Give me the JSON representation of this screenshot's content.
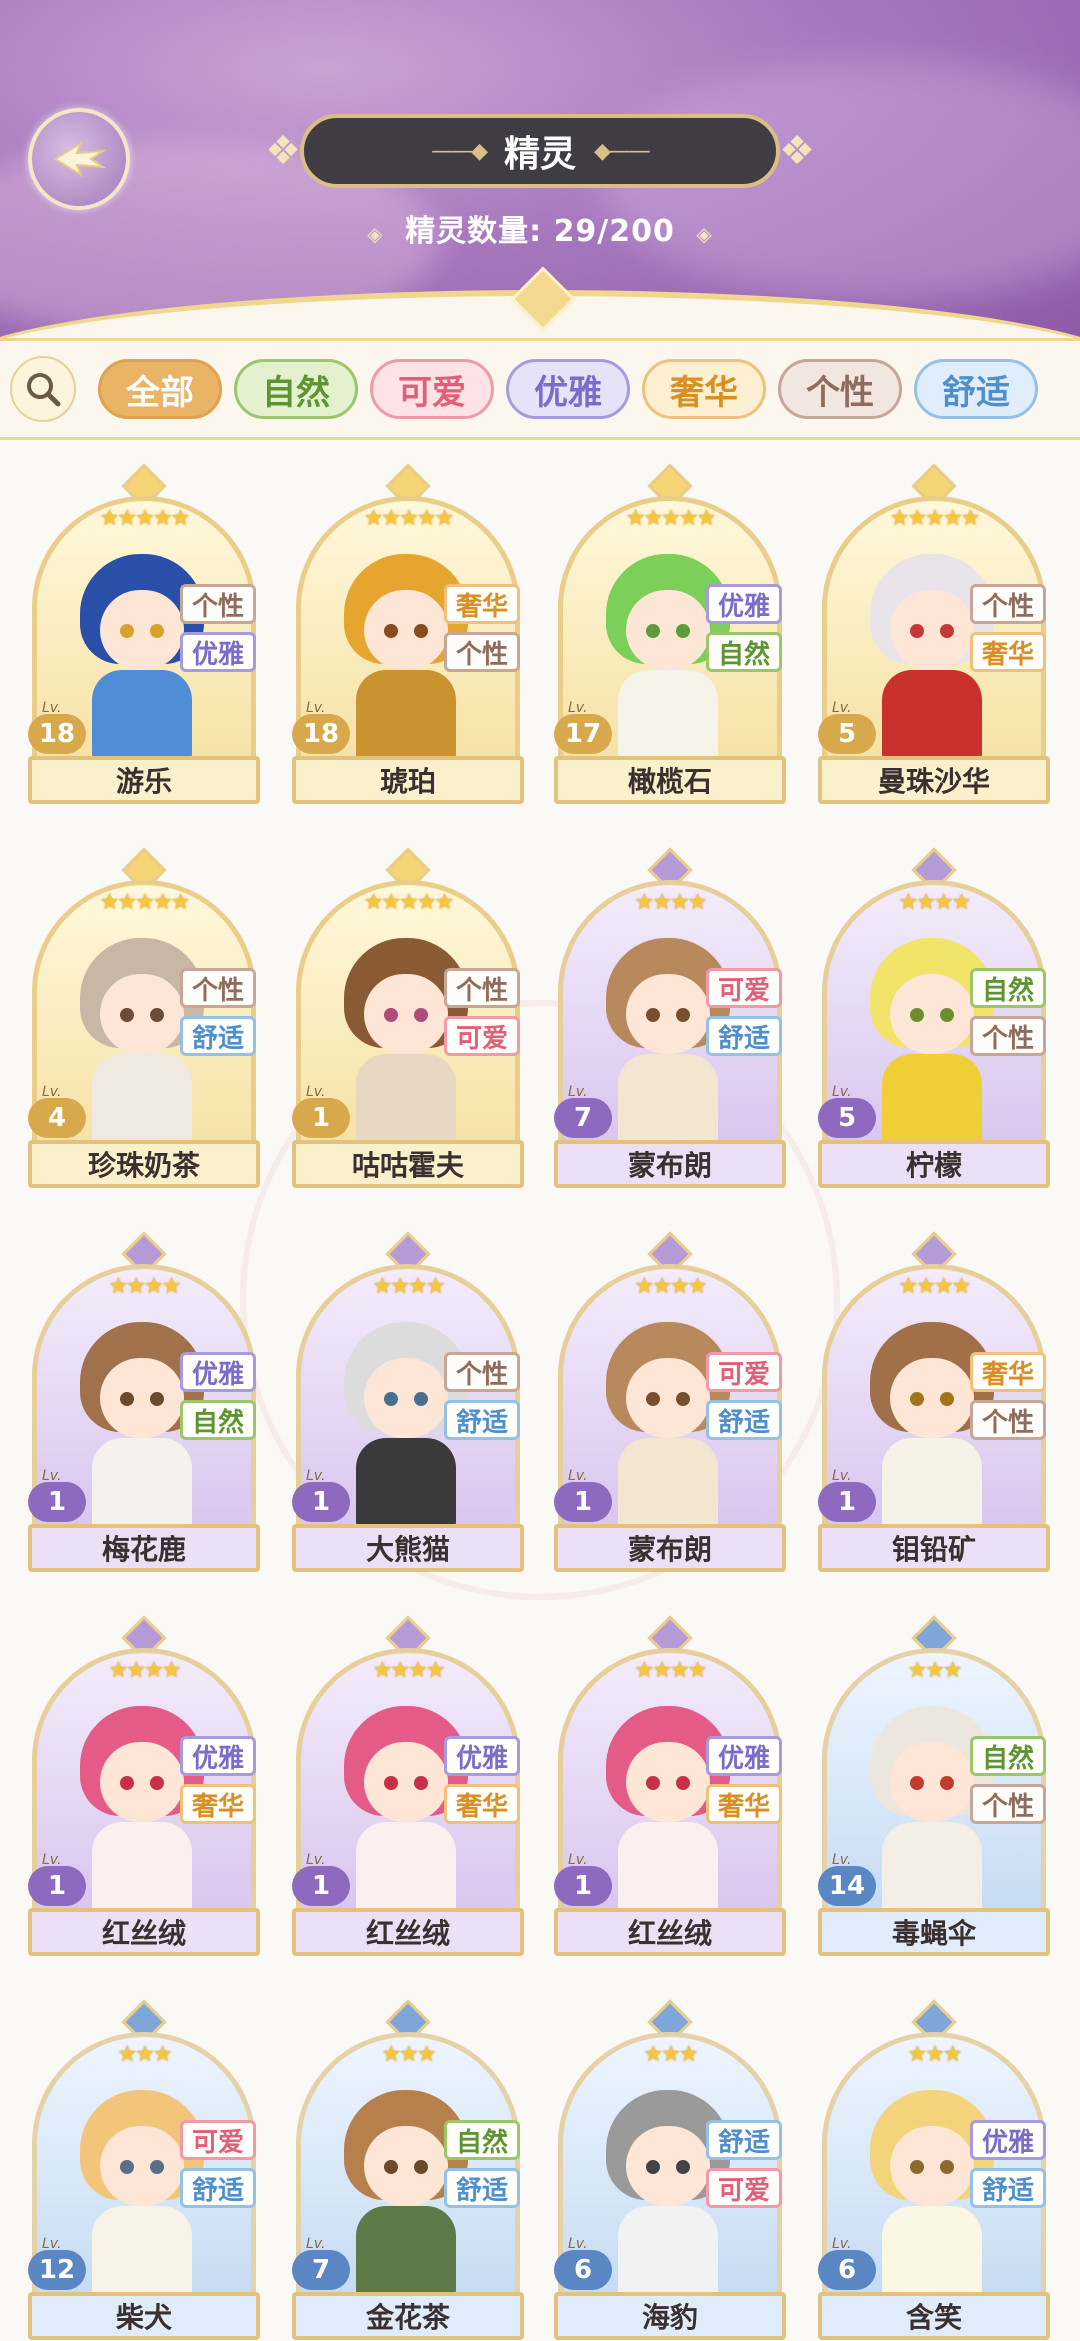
{
  "header": {
    "title": "精灵",
    "count_label": "精灵数量:",
    "count_value": "29/200"
  },
  "filters": [
    {
      "label": "全部",
      "bg": "#eab466",
      "border": "#e0a24f",
      "color": "#ffffff",
      "active": true
    },
    {
      "label": "自然",
      "bg": "#e3f1cf",
      "border": "#9cc66a",
      "color": "#5e9434"
    },
    {
      "label": "可爱",
      "bg": "#fde2e6",
      "border": "#f09aa8",
      "color": "#e0607a"
    },
    {
      "label": "优雅",
      "bg": "#e6e2f8",
      "border": "#a79be0",
      "color": "#7b6cc9"
    },
    {
      "label": "奢华",
      "bg": "#fdf0d2",
      "border": "#eec27a",
      "color": "#d88f24"
    },
    {
      "label": "个性",
      "bg": "#f2e6e1",
      "border": "#c5a697",
      "color": "#8e6d5d"
    },
    {
      "label": "舒适",
      "bg": "#dfeefa",
      "border": "#94c1e6",
      "color": "#4f8fcc"
    }
  ],
  "tag_styles": {
    "个性": {
      "border": "#c5a697",
      "color": "#8e6d5d"
    },
    "优雅": {
      "border": "#a79be0",
      "color": "#7b6cc9"
    },
    "奢华": {
      "border": "#eec27a",
      "color": "#d88f24"
    },
    "自然": {
      "border": "#9cc66a",
      "color": "#5e9434"
    },
    "舒适": {
      "border": "#94c1e6",
      "color": "#4f8fcc"
    },
    "可爱": {
      "border": "#f09aa8",
      "color": "#e0607a"
    }
  },
  "lv_label": "Lv.",
  "spirits": [
    {
      "name": "游乐",
      "level": "18",
      "stars": 5,
      "tags": [
        "个性",
        "优雅"
      ],
      "hair": "#2a4fa8",
      "body": "#4f8ed6",
      "eye": "#d9a12c"
    },
    {
      "name": "琥珀",
      "level": "18",
      "stars": 5,
      "tags": [
        "奢华",
        "个性"
      ],
      "hair": "#e6a52e",
      "body": "#c9932f",
      "eye": "#8a4b1f"
    },
    {
      "name": "橄榄石",
      "level": "17",
      "stars": 5,
      "tags": [
        "优雅",
        "自然"
      ],
      "hair": "#7ccf58",
      "body": "#f4f4ea",
      "eye": "#5d9a3a"
    },
    {
      "name": "曼珠沙华",
      "level": "5",
      "stars": 5,
      "tags": [
        "个性",
        "奢华"
      ],
      "hair": "#e9e3ea",
      "body": "#c9302e",
      "eye": "#c43838"
    },
    {
      "name": "珍珠奶茶",
      "level": "4",
      "stars": 5,
      "tags": [
        "个性",
        "舒适"
      ],
      "hair": "#c9b7a6",
      "body": "#efe9e2",
      "eye": "#6b4c3a"
    },
    {
      "name": "咕咕霍夫",
      "level": "1",
      "stars": 5,
      "tags": [
        "个性",
        "可爱"
      ],
      "hair": "#8a5a34",
      "body": "#e8d7c2",
      "eye": "#b14c7a"
    },
    {
      "name": "蒙布朗",
      "level": "7",
      "stars": 4,
      "tags": [
        "可爱",
        "舒适"
      ],
      "hair": "#b8895c",
      "body": "#f3e6d1",
      "eye": "#7a4f2e"
    },
    {
      "name": "柠檬",
      "level": "5",
      "stars": 4,
      "tags": [
        "自然",
        "个性"
      ],
      "hair": "#f1e468",
      "body": "#efcf35",
      "eye": "#6c8f2e"
    },
    {
      "name": "梅花鹿",
      "level": "1",
      "stars": 4,
      "tags": [
        "优雅",
        "自然"
      ],
      "hair": "#a0714a",
      "body": "#f6f1ea",
      "eye": "#6b4b2c"
    },
    {
      "name": "大熊猫",
      "level": "1",
      "stars": 4,
      "tags": [
        "个性",
        "舒适"
      ],
      "hair": "#dcdcdc",
      "body": "#3a3a3a",
      "eye": "#4a6e90"
    },
    {
      "name": "蒙布朗",
      "level": "1",
      "stars": 4,
      "tags": [
        "可爱",
        "舒适"
      ],
      "hair": "#b8895c",
      "body": "#f3e6d1",
      "eye": "#7a4f2e"
    },
    {
      "name": "钼铅矿",
      "level": "1",
      "stars": 4,
      "tags": [
        "奢华",
        "个性"
      ],
      "hair": "#a27048",
      "body": "#f7f2e8",
      "eye": "#a0741c"
    },
    {
      "name": "红丝绒",
      "level": "1",
      "stars": 4,
      "tags": [
        "优雅",
        "奢华"
      ],
      "hair": "#e45b87",
      "body": "#fbeff0",
      "eye": "#c8304a"
    },
    {
      "name": "红丝绒",
      "level": "1",
      "stars": 4,
      "tags": [
        "优雅",
        "奢华"
      ],
      "hair": "#e45b87",
      "body": "#fbeff0",
      "eye": "#c8304a"
    },
    {
      "name": "红丝绒",
      "level": "1",
      "stars": 4,
      "tags": [
        "优雅",
        "奢华"
      ],
      "hair": "#e45b87",
      "body": "#fbeff0",
      "eye": "#c8304a"
    },
    {
      "name": "毒蝇伞",
      "level": "14",
      "stars": 3,
      "tags": [
        "自然",
        "个性"
      ],
      "hair": "#ede6de",
      "body": "#f4eee6",
      "eye": "#c23a2e"
    },
    {
      "name": "柴犬",
      "level": "12",
      "stars": 3,
      "tags": [
        "可爱",
        "舒适"
      ],
      "hair": "#f2c57a",
      "body": "#f9f2e6",
      "eye": "#5a6e8c"
    },
    {
      "name": "金花茶",
      "level": "7",
      "stars": 3,
      "tags": [
        "自然",
        "舒适"
      ],
      "hair": "#b5804c",
      "body": "#5e7a48",
      "eye": "#6b4a2a"
    },
    {
      "name": "海豹",
      "level": "6",
      "stars": 3,
      "tags": [
        "舒适",
        "可爱"
      ],
      "hair": "#9a9a9a",
      "body": "#f2f2f2",
      "eye": "#444444"
    },
    {
      "name": "含笑",
      "level": "6",
      "stars": 3,
      "tags": [
        "优雅",
        "舒适"
      ],
      "hair": "#f3d47a",
      "body": "#fbf5e4",
      "eye": "#8a6a2c"
    }
  ]
}
